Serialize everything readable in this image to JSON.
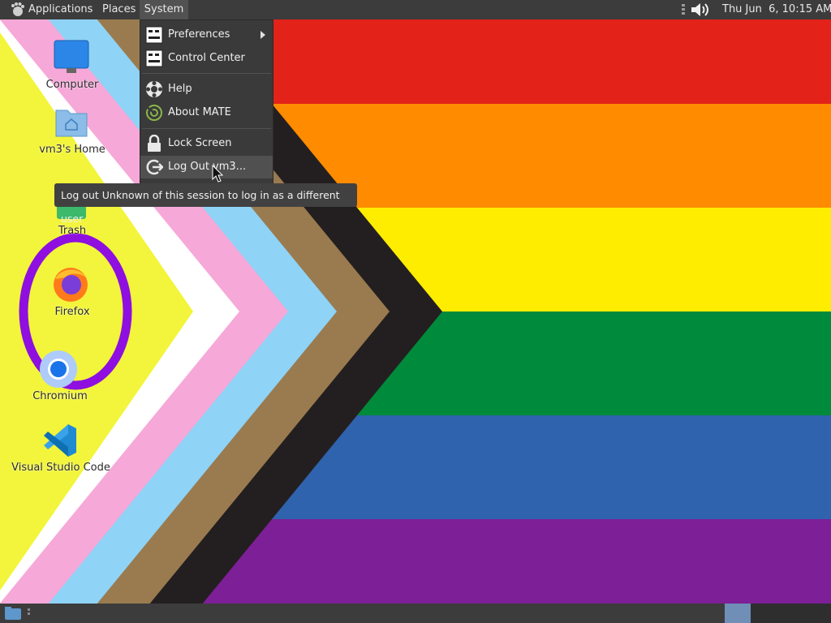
{
  "top_panel": {
    "applications_label": "Applications",
    "places_label": "Places",
    "system_label": "System",
    "clock": "Thu Jun  6, 10:15 AM"
  },
  "system_menu": {
    "items": [
      {
        "label": "Preferences"
      },
      {
        "label": "Control Center"
      },
      {
        "label": "Help"
      },
      {
        "label": "About MATE"
      },
      {
        "label": "Lock Screen"
      },
      {
        "label": "Log Out vm3..."
      }
    ]
  },
  "tooltip": "Log out Unknown of this session to log in as a different user",
  "desktop_icons": [
    {
      "label": "Computer"
    },
    {
      "label": "vm3's Home"
    },
    {
      "label": "Trash"
    },
    {
      "label": "Firefox"
    },
    {
      "label": "Chromium"
    },
    {
      "label": "Visual Studio Code"
    }
  ],
  "colors": {
    "panel": "#3c3c3c",
    "menu": "#3a3a3a",
    "stripes": [
      "#e32219",
      "#ff8b00",
      "#ffed00",
      "#008a3b",
      "#2f63ad",
      "#7d1f96"
    ],
    "chevrons": [
      "#231f20",
      "#9a7b4f",
      "#8fd3f6",
      "#f6a8d8",
      "#ffffff",
      "#f2f53b"
    ],
    "annotation_circle": "#8e0fe0"
  },
  "icons": [
    "foot-icon",
    "volume-icon",
    "arrow-right-icon",
    "preferences-icon",
    "control-center-icon",
    "help-icon",
    "about-icon",
    "lock-icon",
    "logout-icon",
    "computer-icon",
    "home-folder-icon",
    "trash-icon",
    "firefox-icon",
    "chromium-icon",
    "vscode-icon",
    "show-desktop-icon"
  ]
}
